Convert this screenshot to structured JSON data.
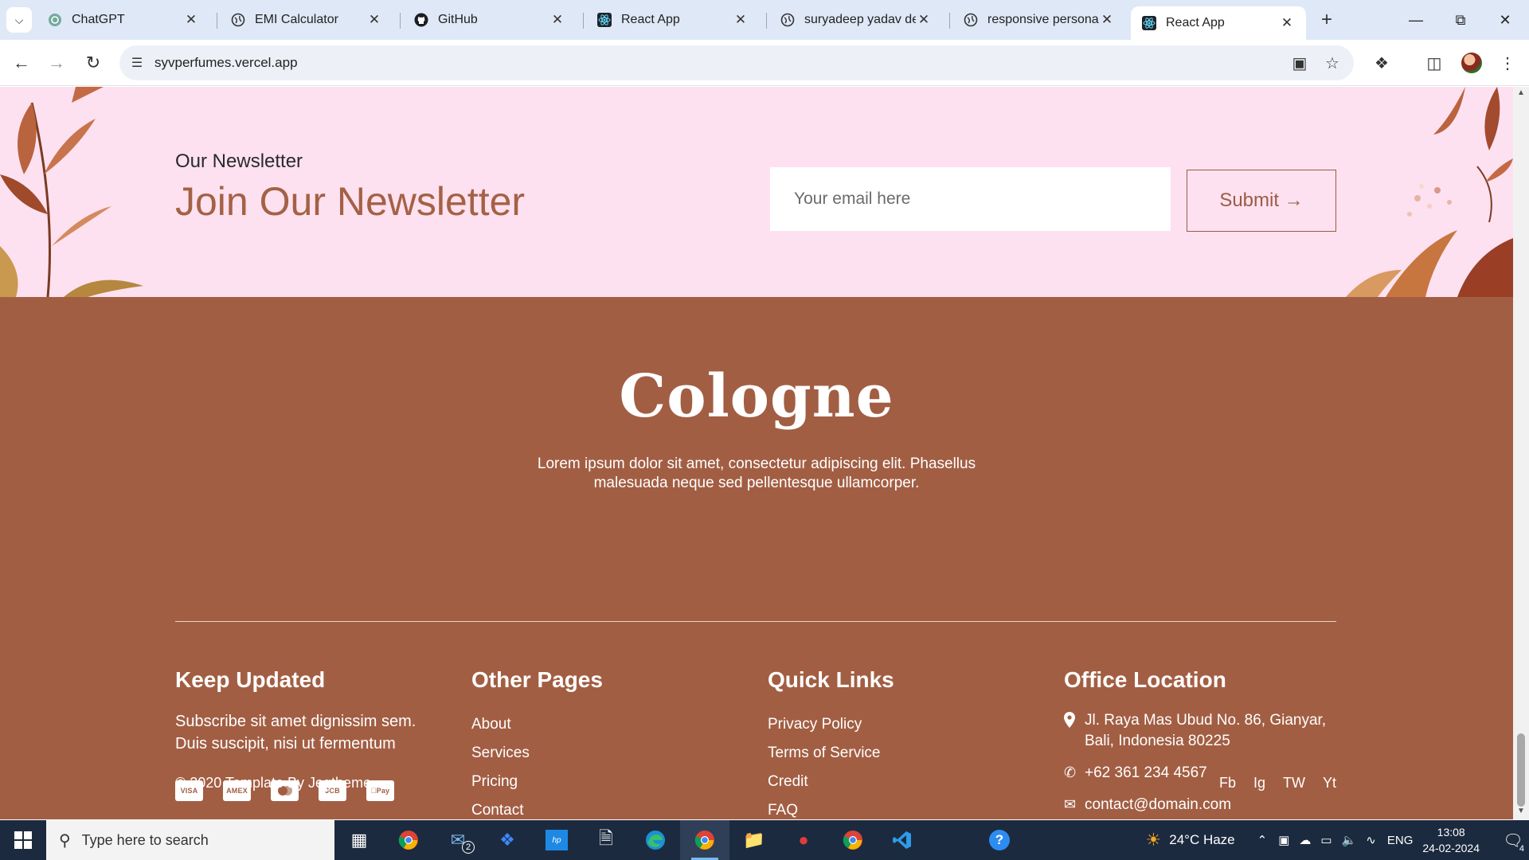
{
  "browser": {
    "tabs": [
      {
        "title": "ChatGPT",
        "icon": "chatgpt-icon"
      },
      {
        "title": "EMI Calculator",
        "icon": "globe-icon"
      },
      {
        "title": "GitHub",
        "icon": "github-icon"
      },
      {
        "title": "React App",
        "icon": "react-icon"
      },
      {
        "title": "suryadeep yadav dev",
        "icon": "globe-icon"
      },
      {
        "title": "responsive personal",
        "icon": "globe-icon"
      },
      {
        "title": "React App",
        "icon": "react-icon",
        "active": true
      }
    ],
    "url": "syvperfumes.vercel.app"
  },
  "newsletter": {
    "eyebrow": "Our Newsletter",
    "title": "Join Our Newsletter",
    "email_placeholder": "Your email here",
    "submit_label": "Submit →"
  },
  "footer": {
    "logo": "Cologne",
    "about": "Lorem ipsum dolor sit amet, consectetur adipiscing elit. Phasellus malesuada neque sed pellentesque ullamcorper.",
    "keep_updated": {
      "title": "Keep Updated",
      "text": "Subscribe sit amet dignissim sem. Duis suscipit, nisi ut fermentum",
      "payments": [
        "VISA",
        "AMEX",
        "MC",
        "JCB",
        "Pay"
      ]
    },
    "other_pages": {
      "title": "Other Pages",
      "links": [
        "About",
        "Services",
        "Pricing",
        "Contact"
      ]
    },
    "quick_links": {
      "title": "Quick Links",
      "links": [
        "Privacy Policy",
        "Terms of Service",
        "Credit",
        "FAQ"
      ]
    },
    "office": {
      "title": "Office Location",
      "address": "Jl. Raya Mas Ubud No. 86, Gianyar, Bali, Indonesia 80225",
      "phone": "+62 361 234 4567",
      "email": "contact@domain.com"
    },
    "copyright": "© 2020 Template By Jegtheme",
    "social": [
      "Fb",
      "Ig",
      "TW",
      "Yt"
    ]
  },
  "taskbar": {
    "search_placeholder": "Type here to search",
    "mail_badge": "2",
    "weather": "24°C  Haze",
    "lang": "ENG",
    "time": "13:08",
    "date": "24-02-2024",
    "notification_count": "4"
  },
  "colors": {
    "newsletter_bg": "#fde1f0",
    "footer_bg": "#a25e43",
    "accent_text": "#a46145",
    "taskbar_bg": "#1c2a3f"
  }
}
